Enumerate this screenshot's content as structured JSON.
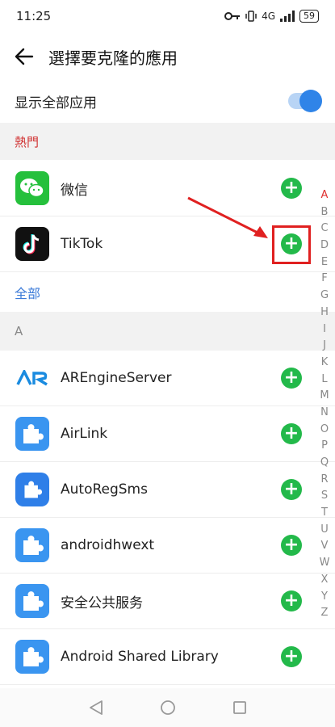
{
  "status_bar": {
    "time": "11:25",
    "network": "4G",
    "battery": "59"
  },
  "header": {
    "title": "選擇要克隆的應用"
  },
  "toggle": {
    "label": "显示全部应用",
    "state": "on"
  },
  "sections": {
    "hot": "熱門",
    "all": "全部",
    "letter_a": "A"
  },
  "hot_apps": [
    {
      "name": "微信",
      "icon": "wechat-icon"
    },
    {
      "name": "TikTok",
      "icon": "tiktok-icon"
    }
  ],
  "all_apps": [
    {
      "name": "AREngineServer",
      "icon": "ar-engine-icon"
    },
    {
      "name": "AirLink",
      "icon": "puzzle-icon"
    },
    {
      "name": "AutoRegSms",
      "icon": "puzzle-icon"
    },
    {
      "name": "androidhwext",
      "icon": "puzzle-icon"
    },
    {
      "name": "安全公共服务",
      "icon": "puzzle-icon"
    },
    {
      "name": "Android Shared Library",
      "icon": "puzzle-icon"
    }
  ],
  "alphabet": [
    "A",
    "B",
    "C",
    "D",
    "E",
    "F",
    "G",
    "H",
    "I",
    "J",
    "K",
    "L",
    "M",
    "N",
    "O",
    "P",
    "Q",
    "R",
    "S",
    "T",
    "U",
    "V",
    "W",
    "X",
    "Y",
    "Z"
  ],
  "colors": {
    "accent": "#2f84e8",
    "add": "#23b94a",
    "hot_section": "#d03030",
    "all_section": "#3a7ad8",
    "annotation": "#e02020"
  }
}
